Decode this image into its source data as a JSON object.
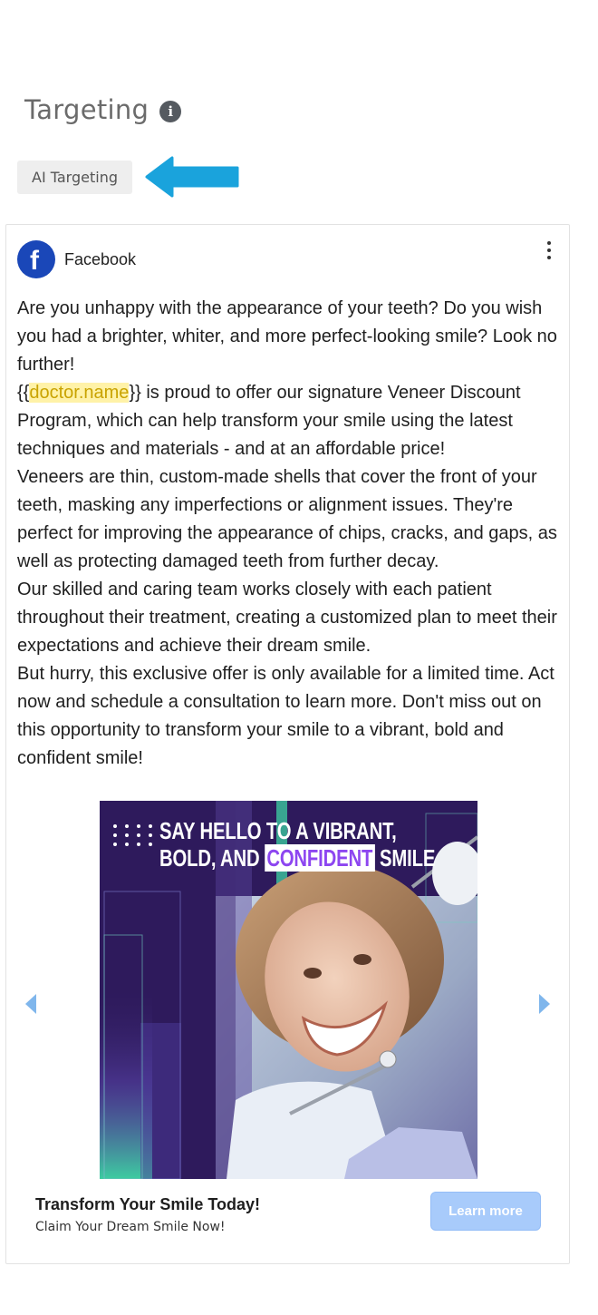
{
  "section": {
    "title": "Targeting",
    "info_icon": "info-icon"
  },
  "chip": {
    "label": "AI Targeting"
  },
  "arrow": {
    "icon": "arrow-left-icon",
    "color": "#1aa3dc"
  },
  "post": {
    "platform": "Facebook",
    "platform_icon": "facebook-logo-icon",
    "menu_icon": "more-vertical-icon",
    "body": {
      "line1": "Are you unhappy with the appearance of your teeth? Do you wish you had a brighter, whiter, and more perfect-looking smile? Look no further!",
      "brace_open": "{{",
      "variable": "doctor.name",
      "brace_close_text": "}} is proud to offer our signature Veneer Discount Program, which can help transform your smile using the latest techniques and materials - and at an affordable price!",
      "line3": "Veneers are thin, custom-made shells that cover the front of your teeth, masking any imperfections or alignment issues. They're perfect for improving the appearance of chips, cracks, and gaps, as well as protecting damaged teeth from further decay.",
      "line4": "Our skilled and caring team works closely with each patient throughout their treatment, creating a customized plan to meet their expectations and achieve their dream smile.",
      "line5": "But hurry, this exclusive offer is only available for a limited time. Act now and schedule a consultation to learn more. Don't miss out on this opportunity to transform your smile to a vibrant, bold and confident smile!"
    },
    "image": {
      "headline_line1": "SAY HELLO TO A VIBRANT,",
      "headline_line2_pre": "BOLD, AND ",
      "headline_line2_accent": "CONFIDENT",
      "headline_line2_post": " SMILE",
      "accent_color": "#8d46f0",
      "background": "#2e1a5c"
    },
    "carousel": {
      "prev_icon": "chevron-left-icon",
      "next_icon": "chevron-right-icon"
    },
    "footer": {
      "title": "Transform Your Smile Today!",
      "subtitle": "Claim Your Dream Smile Now!",
      "cta_label": "Learn more"
    }
  }
}
